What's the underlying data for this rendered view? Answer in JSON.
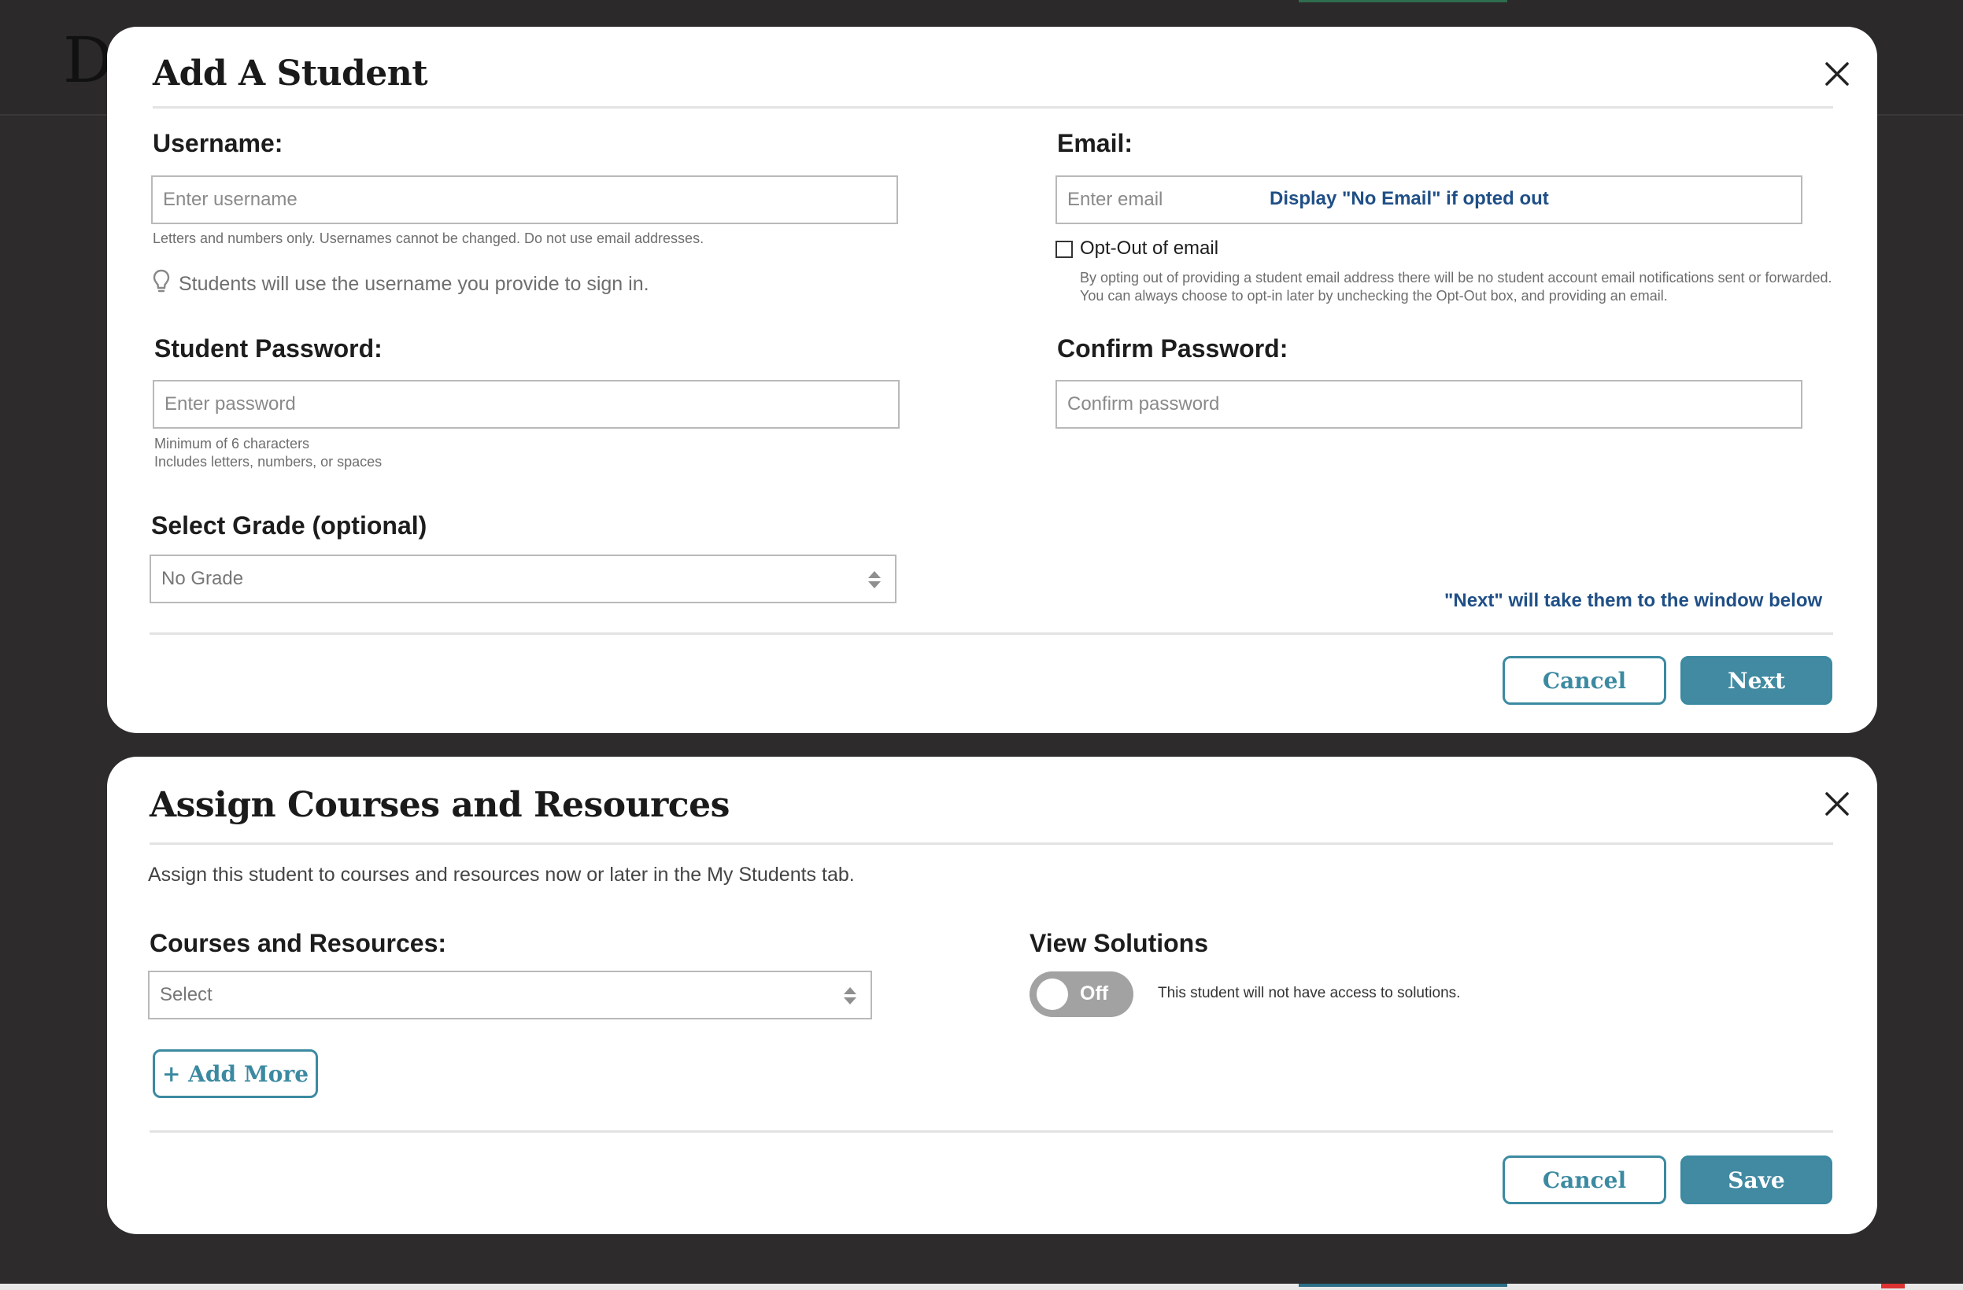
{
  "background": {
    "logo_text": "D"
  },
  "add_student": {
    "title": "Add A Student",
    "username": {
      "label": "Username:",
      "placeholder": "Enter username",
      "hint": "Letters and numbers only. Usernames cannot be changed. Do not use email addresses.",
      "tip": "Students will use the username you provide to sign in."
    },
    "email": {
      "label": "Email:",
      "placeholder": "Enter email",
      "annotation": "Display \"No Email\" if opted out",
      "opt_out_label": "Opt-Out of email",
      "opt_out_desc": "By opting out of providing a student email address there will be no student account email notifications sent or forwarded. You can always choose to opt-in later by unchecking the Opt-Out box, and providing an email."
    },
    "password": {
      "label": "Student Password:",
      "placeholder": "Enter password",
      "hint_1": "Minimum of 6 characters",
      "hint_2": "Includes letters, numbers, or spaces"
    },
    "confirm_password": {
      "label": "Confirm Password:",
      "placeholder": "Confirm password"
    },
    "grade": {
      "label": "Select Grade (optional)",
      "selected": "No Grade"
    },
    "next_annotation": "\"Next\" will take them to the window below",
    "cancel_label": "Cancel",
    "next_label": "Next"
  },
  "assign_courses": {
    "title": "Assign Courses and Resources",
    "subtitle": "Assign this student to courses and resources now or later in the My Students tab.",
    "courses": {
      "label": "Courses and Resources:",
      "selected": "Select"
    },
    "add_more_label": "+ Add More",
    "view_solutions": {
      "label": "View Solutions",
      "toggle_text": "Off",
      "description": "This student will not have access to solutions."
    },
    "cancel_label": "Cancel",
    "save_label": "Save"
  },
  "colors": {
    "accent": "#418aa2",
    "annotation": "#1f4f86",
    "overlay": "#2d2b2b"
  },
  "icons": {
    "close": "close-icon",
    "tip": "lightbulb-icon",
    "select_arrows": "sort-arrows-icon"
  }
}
